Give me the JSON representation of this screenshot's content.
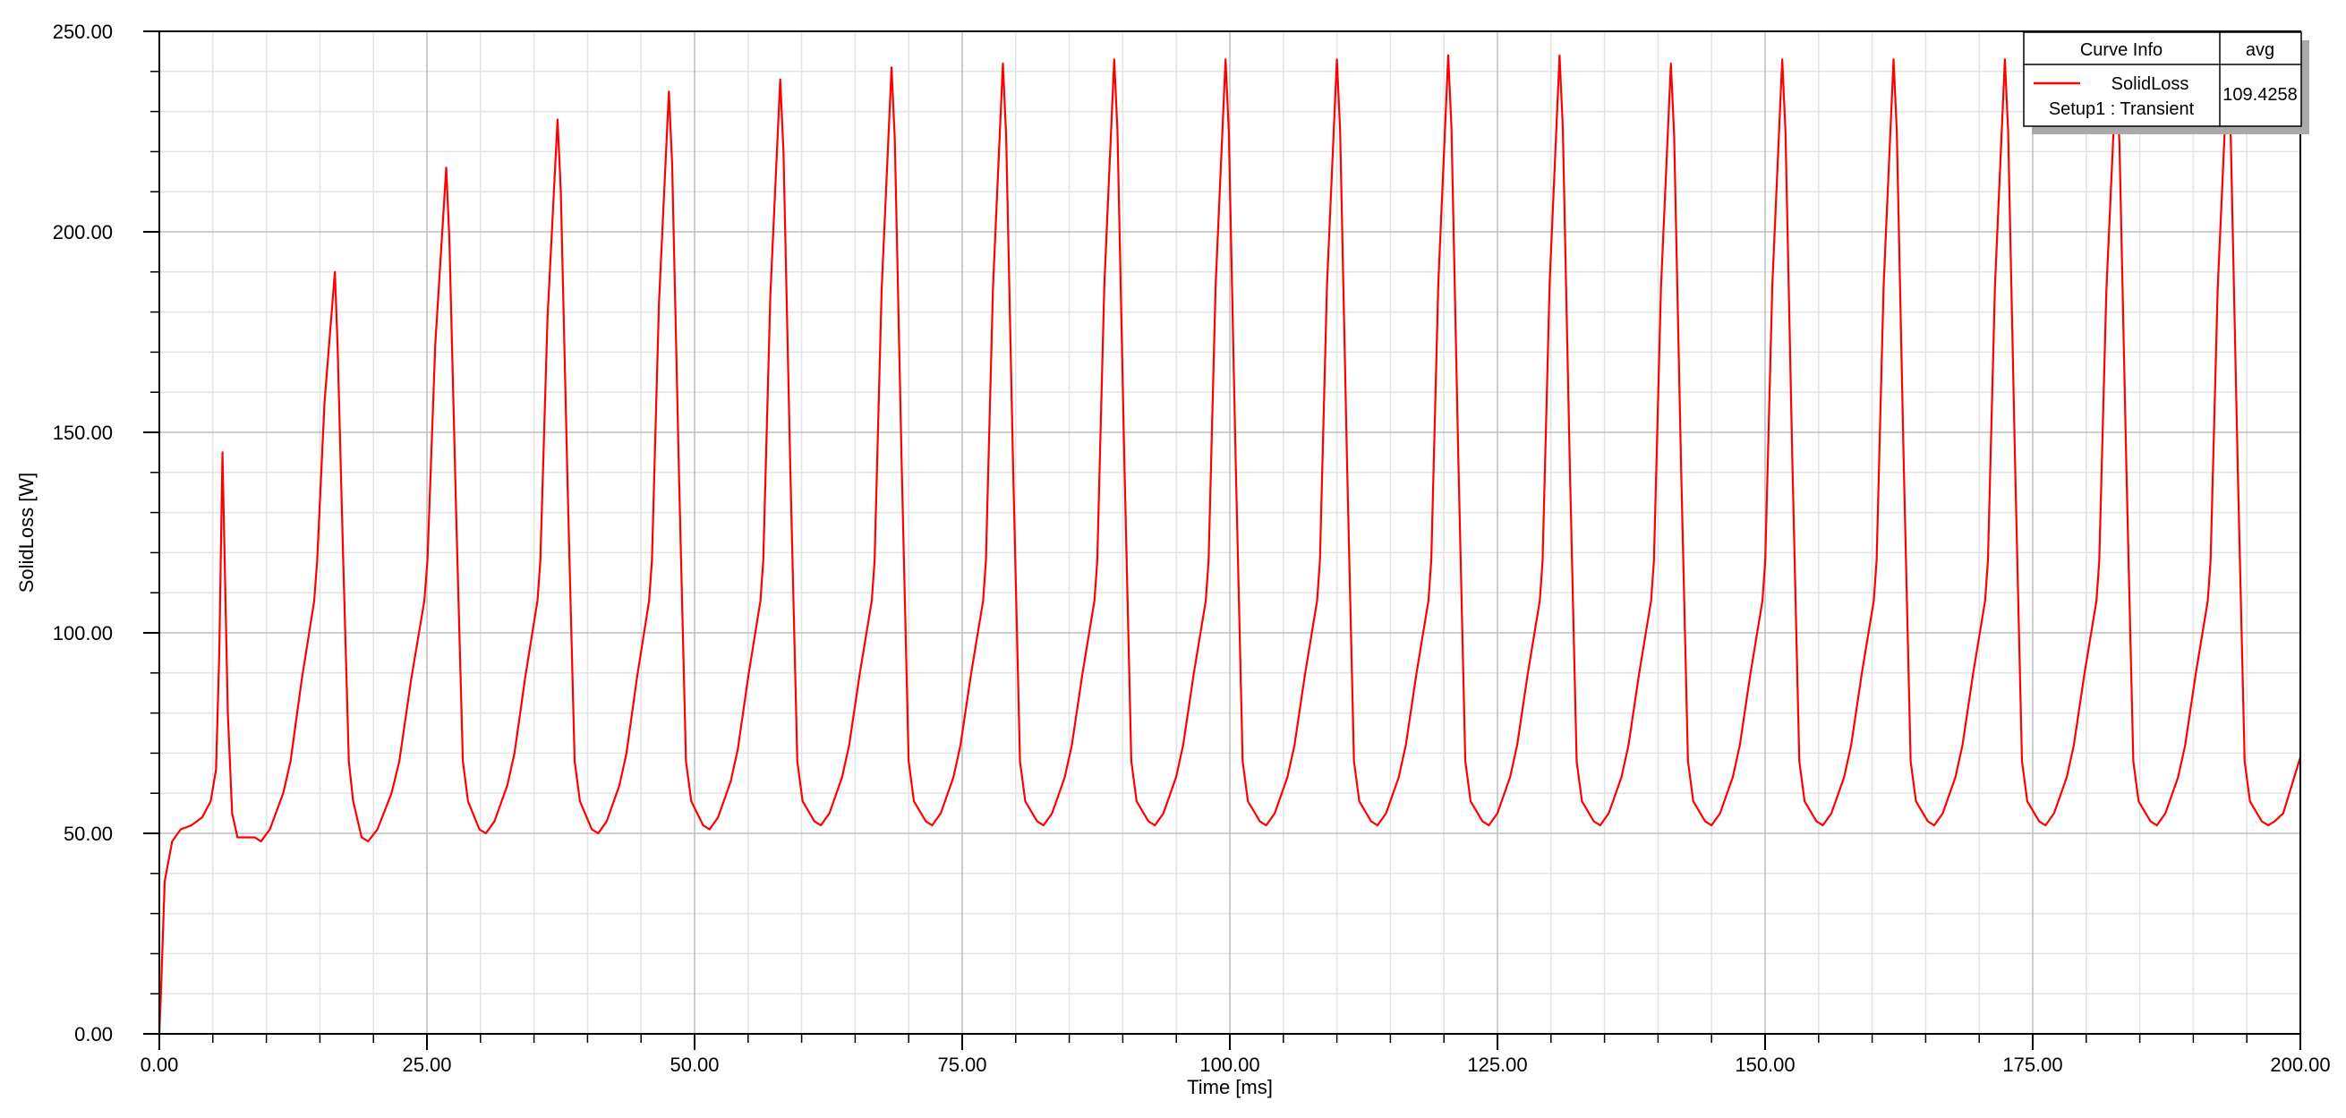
{
  "chart_data": {
    "type": "line",
    "title": "",
    "xlabel": "Time [ms]",
    "ylabel": "SolidLoss [W]",
    "xlim": [
      0,
      200
    ],
    "ylim": [
      0,
      250
    ],
    "x_ticks": [
      "0.00",
      "25.00",
      "50.00",
      "75.00",
      "100.00",
      "125.00",
      "150.00",
      "175.00",
      "200.00"
    ],
    "y_ticks": [
      "0.00",
      "50.00",
      "100.00",
      "150.00",
      "200.00",
      "250.00"
    ],
    "grid": true,
    "legend_position": "top-right",
    "series": [
      {
        "name": "SolidLoss",
        "color": "#ff0000",
        "period_ms": 10.4,
        "peaks": [
          {
            "x": 5.9,
            "y": 145
          },
          {
            "x": 16.4,
            "y": 190
          },
          {
            "x": 26.8,
            "y": 216
          },
          {
            "x": 37.2,
            "y": 228
          },
          {
            "x": 47.6,
            "y": 235
          },
          {
            "x": 58.0,
            "y": 238
          },
          {
            "x": 68.4,
            "y": 241
          },
          {
            "x": 78.8,
            "y": 242
          },
          {
            "x": 89.2,
            "y": 243
          },
          {
            "x": 99.6,
            "y": 243
          },
          {
            "x": 110.0,
            "y": 243
          },
          {
            "x": 120.4,
            "y": 244
          },
          {
            "x": 130.8,
            "y": 244
          },
          {
            "x": 141.2,
            "y": 242
          },
          {
            "x": 151.6,
            "y": 243
          },
          {
            "x": 162.0,
            "y": 243
          },
          {
            "x": 172.4,
            "y": 243
          },
          {
            "x": 182.8,
            "y": 240
          },
          {
            "x": 193.2,
            "y": 241
          }
        ],
        "troughs": [
          {
            "x": 9.5,
            "y": 48
          },
          {
            "x": 19.5,
            "y": 48
          },
          {
            "x": 30.5,
            "y": 50
          },
          {
            "x": 41.0,
            "y": 50
          },
          {
            "x": 51.4,
            "y": 51
          },
          {
            "x": 61.8,
            "y": 52
          },
          {
            "x": 72.2,
            "y": 52
          },
          {
            "x": 82.6,
            "y": 52
          },
          {
            "x": 93.0,
            "y": 52
          },
          {
            "x": 103.4,
            "y": 52
          },
          {
            "x": 113.8,
            "y": 52
          },
          {
            "x": 124.2,
            "y": 52
          },
          {
            "x": 134.6,
            "y": 52
          },
          {
            "x": 145.0,
            "y": 52
          },
          {
            "x": 155.4,
            "y": 52
          },
          {
            "x": 165.8,
            "y": 52
          },
          {
            "x": 176.2,
            "y": 52
          },
          {
            "x": 186.6,
            "y": 52
          },
          {
            "x": 197.0,
            "y": 52
          }
        ],
        "end_value": {
          "x": 200,
          "y": 69
        }
      }
    ],
    "legend": {
      "header": "Curve Info",
      "column": "avg",
      "line1": "SolidLoss",
      "line2": "Setup1 : Transient",
      "value": "109.4258"
    }
  }
}
